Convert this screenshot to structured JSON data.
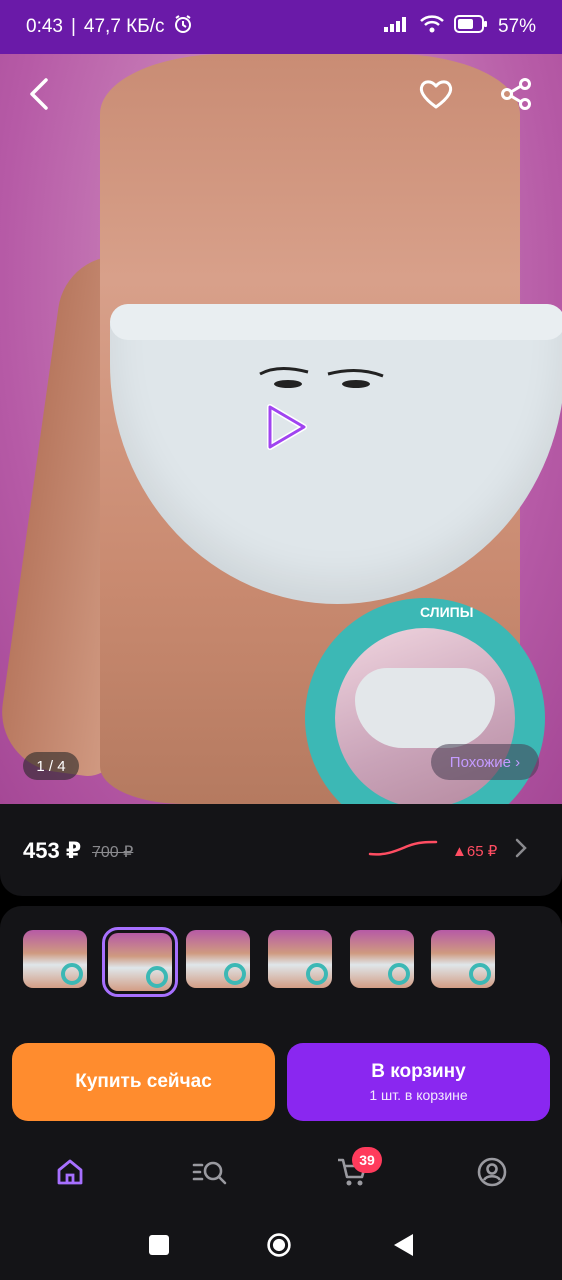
{
  "status_bar": {
    "time": "0:43",
    "separator": "|",
    "speed": "47,7 КБ/с",
    "battery_percent": "57%",
    "icons": [
      "alarm-icon",
      "signal-icon",
      "wifi-icon",
      "battery-icon"
    ]
  },
  "hero": {
    "back_icon": "chevron-left-icon",
    "favorite_icon": "heart-icon",
    "share_icon": "share-icon",
    "play_icon": "play-icon",
    "counter": "1 / 4",
    "similar_label": "Похожие ›",
    "badge_text": "СЛИПЫ"
  },
  "price": {
    "current": "453 ₽",
    "old": "700 ₽",
    "delta": "▲65 ₽",
    "trend_color": "#ff4d62",
    "arrow_icon": "chevron-right-icon"
  },
  "thumbnails": {
    "count": 6,
    "selected_index": 1
  },
  "actions": {
    "buy_now": "Купить сейчас",
    "add_to_cart": "В корзину",
    "in_cart": "1 шт. в корзине",
    "buy_color": "#ff8c2e",
    "cart_color": "#8a27f0"
  },
  "bottom_nav": {
    "items": [
      "home-icon",
      "catalog-search-icon",
      "cart-icon",
      "profile-icon"
    ],
    "active": "home-icon",
    "cart_badge": "39"
  },
  "system_nav": {
    "items": [
      "recents-icon",
      "home-circle-icon",
      "back-triangle-icon"
    ]
  }
}
